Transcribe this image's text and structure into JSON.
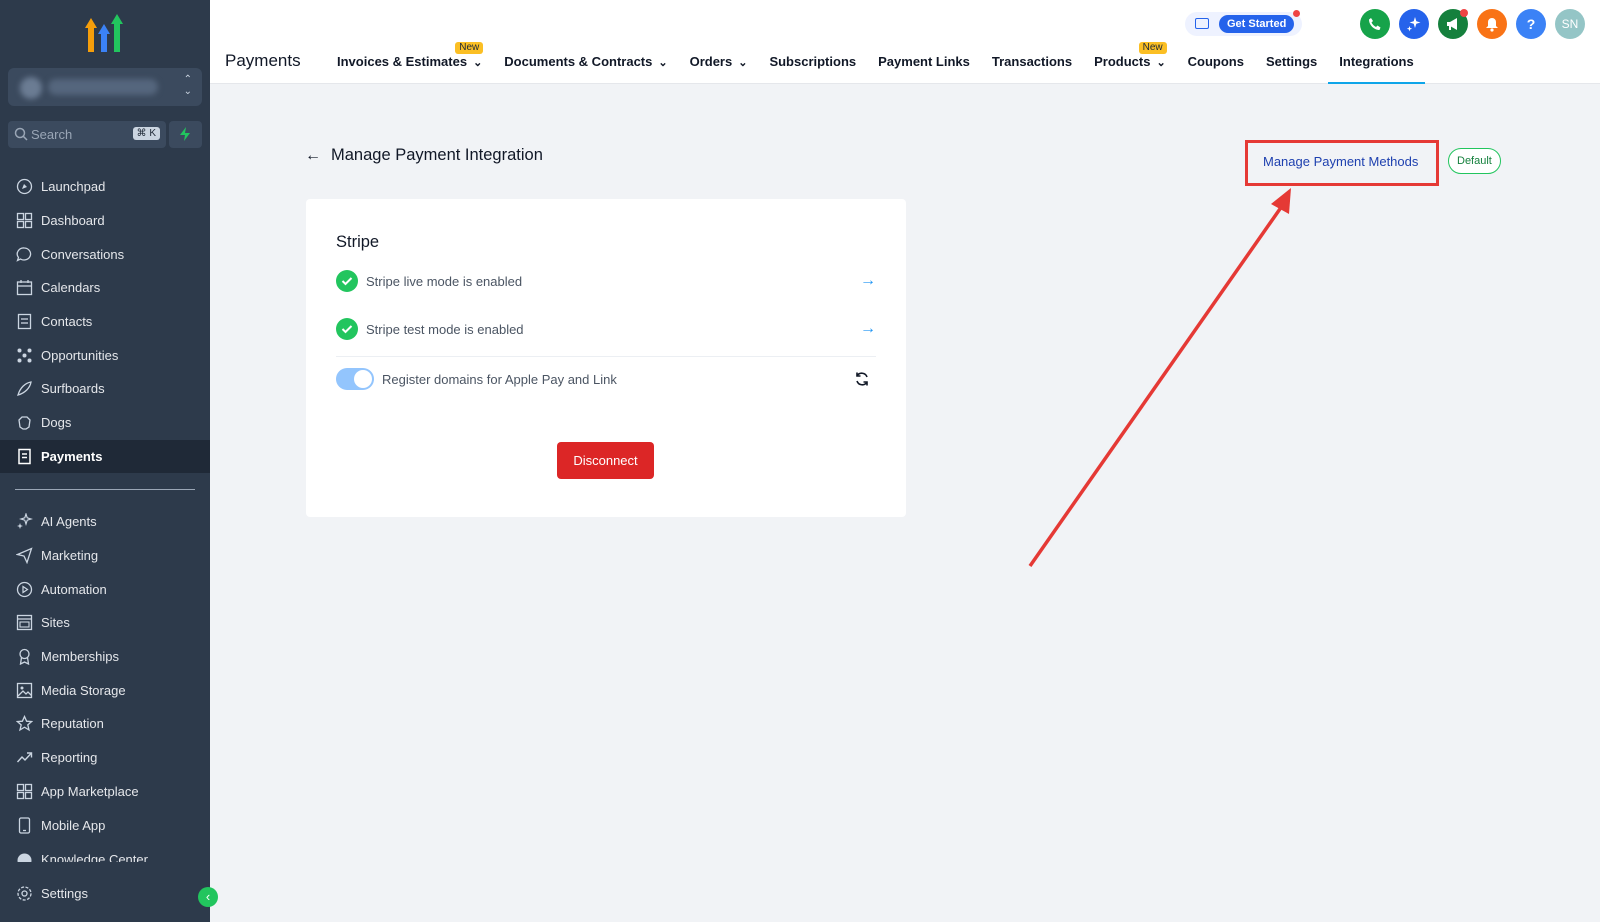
{
  "sidebar": {
    "search": {
      "label": "Search",
      "shortcut": "⌘ K"
    },
    "items": [
      {
        "label": "Launchpad",
        "icon": "launchpad-icon"
      },
      {
        "label": "Dashboard",
        "icon": "dashboard-icon"
      },
      {
        "label": "Conversations",
        "icon": "chat-icon"
      },
      {
        "label": "Calendars",
        "icon": "calendar-icon"
      },
      {
        "label": "Contacts",
        "icon": "contacts-icon"
      },
      {
        "label": "Opportunities",
        "icon": "opportunities-icon"
      },
      {
        "label": "Surfboards",
        "icon": "surfboard-icon"
      },
      {
        "label": "Dogs",
        "icon": "paw-icon"
      },
      {
        "label": "Payments",
        "icon": "payments-icon",
        "active": true
      }
    ],
    "items2": [
      {
        "label": "AI Agents",
        "icon": "sparkle-icon"
      },
      {
        "label": "Marketing",
        "icon": "send-icon"
      },
      {
        "label": "Automation",
        "icon": "automation-icon"
      },
      {
        "label": "Sites",
        "icon": "sites-icon"
      },
      {
        "label": "Memberships",
        "icon": "award-icon"
      },
      {
        "label": "Media Storage",
        "icon": "image-icon"
      },
      {
        "label": "Reputation",
        "icon": "star-icon"
      },
      {
        "label": "Reporting",
        "icon": "trend-icon"
      },
      {
        "label": "App Marketplace",
        "icon": "grid-icon"
      },
      {
        "label": "Mobile App",
        "icon": "mobile-icon"
      },
      {
        "label": "Knowledge Center",
        "icon": "book-icon"
      }
    ],
    "settings": "Settings"
  },
  "header": {
    "title": "Payments",
    "tabs": [
      {
        "label": "Invoices & Estimates",
        "badge": "New",
        "dropdown": true
      },
      {
        "label": "Documents & Contracts",
        "dropdown": true
      },
      {
        "label": "Orders",
        "dropdown": true
      },
      {
        "label": "Subscriptions"
      },
      {
        "label": "Payment Links"
      },
      {
        "label": "Transactions"
      },
      {
        "label": "Products",
        "badge": "New",
        "dropdown": true
      },
      {
        "label": "Coupons"
      },
      {
        "label": "Settings"
      },
      {
        "label": "Integrations",
        "active": true
      }
    ],
    "get_started": "Get Started",
    "avatar": "SN",
    "help": "?"
  },
  "main": {
    "back_title": "Manage Payment Integration",
    "manage_link": "Manage Payment Methods",
    "default_badge": "Default",
    "card": {
      "heading": "Stripe",
      "live": "Stripe live mode is enabled",
      "test": "Stripe test mode is enabled",
      "domains": "Register domains for Apple Pay and Link",
      "disconnect": "Disconnect"
    }
  },
  "colors": {
    "sidebar": "#2d3a4b",
    "accent": "#2563eb",
    "success": "#22c55e",
    "danger": "#dc2626",
    "annotation": "#e53935"
  }
}
